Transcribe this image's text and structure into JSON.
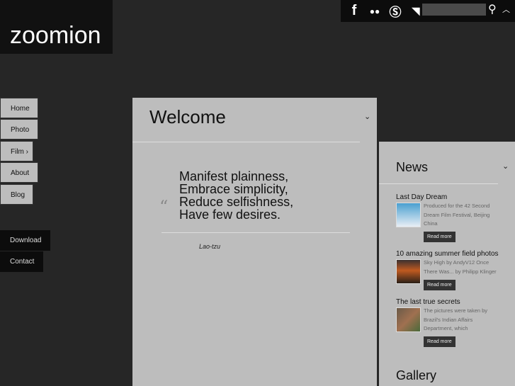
{
  "logo": "zoomion",
  "topbar": {
    "icons": [
      "facebook-icon",
      "flickr-icon",
      "skype-icon",
      "rss-icon"
    ],
    "search_placeholder": ""
  },
  "nav": [
    "Home",
    "Photo",
    "Film",
    "About",
    "Blog"
  ],
  "nav_secondary": [
    "Download",
    "Contact"
  ],
  "welcome": {
    "title": "Welcome",
    "quote": [
      "Manifest plainness,",
      "Embrace simplicity,",
      "Reduce selfishness,",
      "Have few desires."
    ],
    "author": "Lao-tzu"
  },
  "news": {
    "title": "News",
    "items": [
      {
        "title": "Last Day Dream",
        "desc": "Produced for the 42 Second Dream Film Festival, Beijing China",
        "button": "Read more"
      },
      {
        "title": "10 amazing summer field photos",
        "desc": "Sky High by AndyV12 Once There Was... by Philipp Klinger",
        "button": "Read more"
      },
      {
        "title": "The last true secrets",
        "desc": "The pictures were taken by Brazil's Indian Affairs Department, which",
        "button": "Read more"
      }
    ]
  },
  "gallery": {
    "title": "Gallery"
  }
}
